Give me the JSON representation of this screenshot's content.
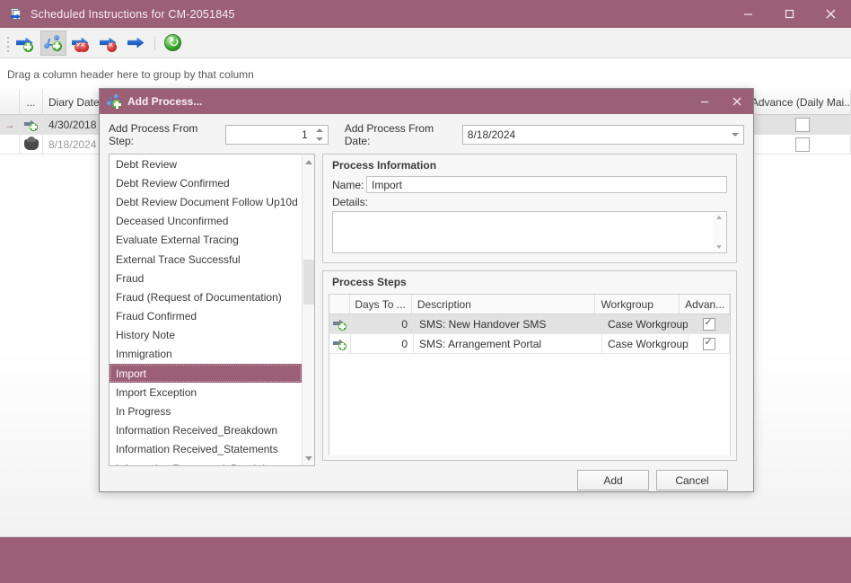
{
  "main_window": {
    "title": "Scheduled Instructions for CM-2051845",
    "icon": "scheduled-instructions-icon",
    "minimize": "–",
    "maximize": "□",
    "close": "✕",
    "accent_color": "#9b5f76"
  },
  "toolbar": {
    "buttons": [
      {
        "name": "add-instruction-icon",
        "icon": "blue-arrow-add"
      },
      {
        "name": "add-process-icon",
        "icon": "process-node-add",
        "active": true
      },
      {
        "name": "delete-all-instructions-icon",
        "icon": "blue-arrow-delete-all"
      },
      {
        "name": "delete-instruction-icon",
        "icon": "blue-arrow-delete"
      },
      {
        "name": "execute-instruction-icon",
        "icon": "blue-arrow"
      },
      {
        "name": "refresh-icon",
        "icon": "green-refresh"
      }
    ]
  },
  "group_panel": {
    "hint": "Drag a column header here to group by that column"
  },
  "background_grid": {
    "columns": [
      "",
      "...",
      "Diary Date",
      "",
      "Advance (Daily Mai..."
    ],
    "rows": [
      {
        "indicator": "→",
        "icon": "instruction-icon",
        "diary_date": "4/30/2018",
        "advance_checked": false,
        "selected": true
      },
      {
        "indicator": "",
        "icon": "phone-icon",
        "diary_date": "8/18/2024",
        "advance_checked": false,
        "selected": false
      }
    ]
  },
  "dialog": {
    "title": "Add Process...",
    "icon": "add-process-icon",
    "minimize": "–",
    "close": "✕",
    "from_step": {
      "label": "Add Process From Step:",
      "value": "1"
    },
    "from_date": {
      "label": "Add Process From Date:",
      "value": "8/18/2024"
    },
    "process_list": {
      "items": [
        "Debt Review",
        "Debt Review Confirmed",
        "Debt Review Document Follow Up10d",
        "Deceased Unconfirmed",
        "Evaluate External Tracing",
        "External Trace Successful",
        "Fraud",
        "Fraud (Request of Documentation)",
        "Fraud Confirmed",
        "History Note",
        "Immigration",
        "Import",
        "Import Exception",
        "In Progress",
        "Information Received_Breakdown",
        "Information Received_Statements",
        "Information Requested_Breakdown"
      ],
      "selected": "Import",
      "selected_index": 11
    },
    "process_information": {
      "title": "Process Information",
      "name_label": "Name:",
      "name_value": "Import",
      "details_label": "Details:",
      "details_value": ""
    },
    "process_steps": {
      "title": "Process Steps",
      "columns": [
        "",
        "Days To ...",
        "Description",
        "Workgroup",
        "Advan..."
      ],
      "rows": [
        {
          "icon": "step-icon",
          "days_to": "0",
          "description": "SMS: New Handover SMS",
          "workgroup": "Case Workgroup",
          "advance_checked": true,
          "selected": true
        },
        {
          "icon": "step-icon",
          "days_to": "0",
          "description": "SMS: Arrangement Portal",
          "workgroup": "Case Workgroup",
          "advance_checked": true,
          "selected": false
        }
      ]
    },
    "buttons": {
      "add": "Add",
      "cancel": "Cancel"
    }
  }
}
